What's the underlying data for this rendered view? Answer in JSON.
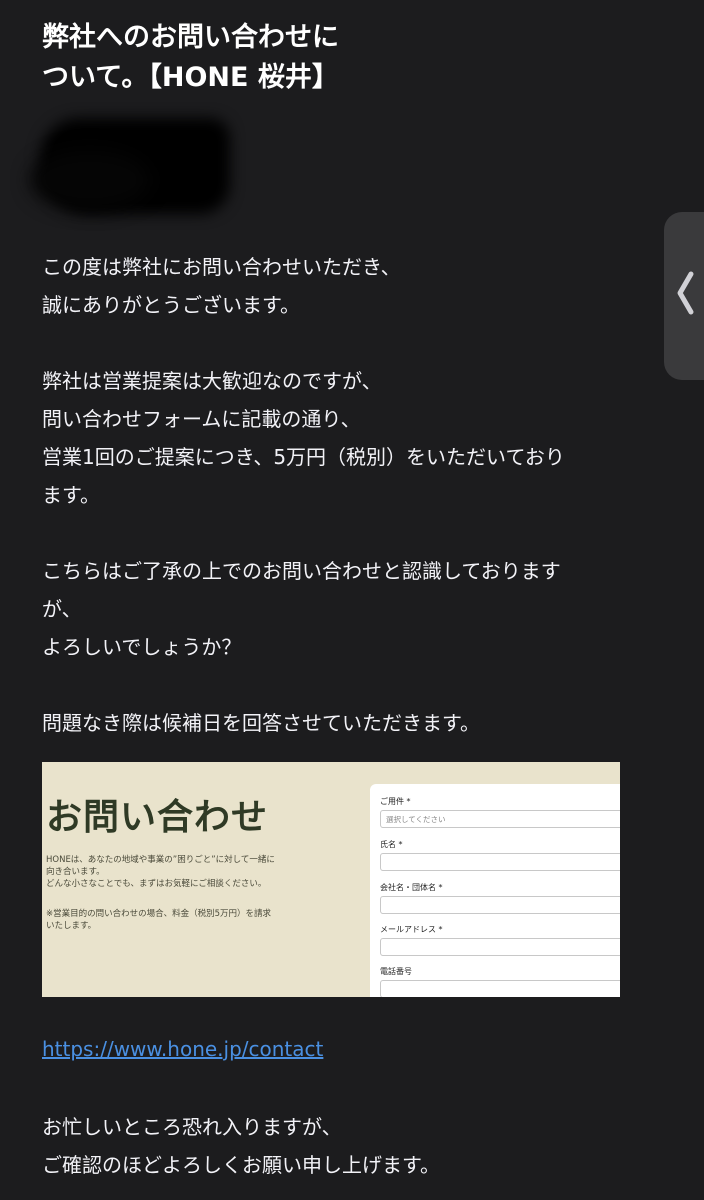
{
  "email": {
    "subject_lines": [
      "弊社へのお問い合わせに",
      "ついて。【HONE 桜井】"
    ],
    "paragraphs": [
      [
        "この度は弊社にお問い合わせいただき、",
        "誠にありがとうございます。"
      ],
      [
        "弊社は営業提案は大歓迎なのですが、",
        "問い合わせフォームに記載の通り、",
        "営業1回のご提案につき、5万円（税別）をいただいており",
        "ます。"
      ],
      [
        "こちらはご了承の上でのお問い合わせと認識しております",
        "が、",
        "よろしいでしょうか？"
      ],
      [
        "問題なき際は候補日を回答させていただきます。"
      ]
    ],
    "link": "https://www.hone.jp/contact",
    "closing": [
      "お忙しいところ恐れ入りますが、",
      "ご確認のほどよろしくお願い申し上げます。"
    ]
  },
  "preview": {
    "title": "お問い合わせ",
    "desc_lines": [
      "HONEは、あなたの地域や事業の”困りごと”に対して一緒に",
      "向き合います。",
      "どんな小さなことでも、まずはお気軽にご相談ください。"
    ],
    "note_lines": [
      "※営業目的の問い合わせの場合、料金（税別5万円）を請求",
      "いたします。"
    ],
    "fields": [
      {
        "label": "ご用件 *",
        "placeholder": "選択してください"
      },
      {
        "label": "氏名 *",
        "placeholder": ""
      },
      {
        "label": "会社名・団体名 *",
        "placeholder": ""
      },
      {
        "label": "メールアドレス *",
        "placeholder": ""
      },
      {
        "label": "電話番号",
        "placeholder": ""
      }
    ]
  },
  "colors": {
    "background": "#1c1c1e",
    "text": "#f2f2f7",
    "link": "#4a90e2",
    "preview_bg": "#e9e3cc",
    "preview_title": "#2f3a25"
  },
  "icons": {
    "side_tab": "chevron-left-icon"
  }
}
